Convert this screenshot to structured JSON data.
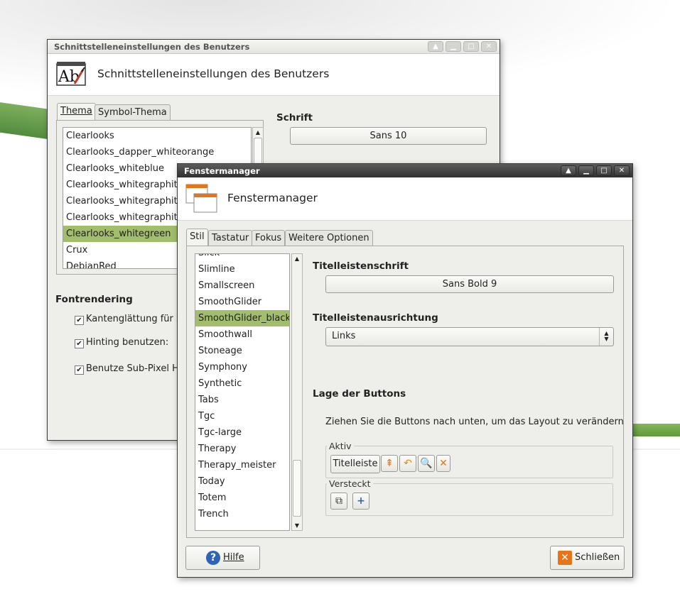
{
  "colors": {
    "accent_selection": "#a2bd6b",
    "desktop_green": "#5f9a3b",
    "close_icon_orange": "#e8741a",
    "help_icon_blue": "#2f63b6"
  },
  "win_user_settings": {
    "title": "Schnittstelleneinstellungen des Benutzers",
    "header_title": "Schnittstelleneinstellungen des Benutzers",
    "header_icon": "font-settings-icon",
    "tabs": [
      "Thema",
      "Symbol-Thema"
    ],
    "themes": [
      "Clearlooks",
      "Clearlooks_dapper_whiteorange",
      "Clearlooks_whiteblue",
      "Clearlooks_whitegraphite",
      "Clearlooks_whitegraphite",
      "Clearlooks_whitegraphite",
      "Clearlooks_whitegreen",
      "Crux",
      "DebianRed"
    ],
    "selected_theme": "Clearlooks_whitegreen",
    "font_section": "Schrift",
    "font_value": "Sans 10",
    "fontrender_section": "Fontrendering",
    "checks": [
      {
        "label": "Kantenglättung für S",
        "checked": true
      },
      {
        "label": "Hinting benutzen:",
        "checked": true
      },
      {
        "label": "Benutze Sub-Pixel Hi",
        "checked": true
      }
    ]
  },
  "win_wm": {
    "title": "Fenstermanager",
    "header_title": "Fenstermanager",
    "header_icon": "window-manager-icon",
    "tabs": [
      "Stil",
      "Tastatur",
      "Fokus",
      "Weitere Optionen"
    ],
    "styles": [
      "Slick",
      "Slimline",
      "Smallscreen",
      "SmoothGlider",
      "SmoothGlider_black",
      "Smoothwall",
      "Stoneage",
      "Symphony",
      "Synthetic",
      "Tabs",
      "Tgc",
      "Tgc-large",
      "Therapy",
      "Therapy_meister",
      "Today",
      "Totem",
      "Trench"
    ],
    "selected_style": "SmoothGlider_black",
    "titlefont_section": "Titelleistenschrift",
    "titlefont_value": "Sans Bold 9",
    "align_section": "Titelleistenausrichtung",
    "align_value": "Links",
    "buttons_section": "Lage der Buttons",
    "buttons_hint": "Ziehen Sie die Buttons nach unten, um das Layout zu verändern",
    "active_legend": "Aktiv",
    "active_title_button": "Titelleiste",
    "active_icons": [
      "shade-icon",
      "undo-icon",
      "zoom-icon",
      "close-icon"
    ],
    "hidden_legend": "Versteckt",
    "hidden_icons": [
      "sticky-icon",
      "add-icon"
    ],
    "help_button": "Hilfe",
    "close_button": "Schließen"
  },
  "titlebar_icons": [
    "shade-up-icon",
    "minimize-icon",
    "maximize-icon",
    "close-icon"
  ]
}
